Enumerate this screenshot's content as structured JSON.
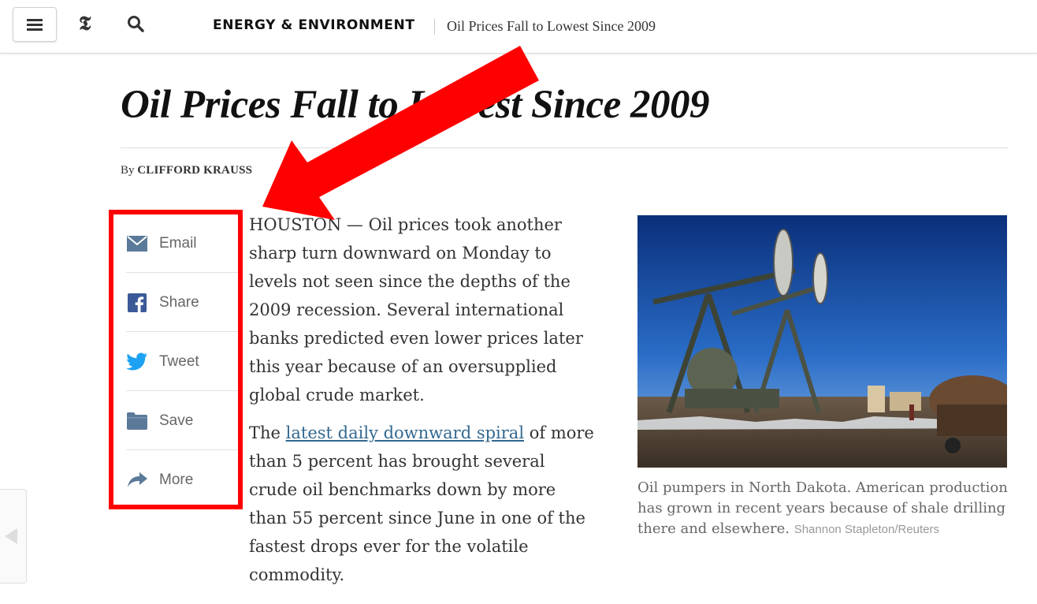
{
  "header": {
    "section": "ENERGY & ENVIRONMENT",
    "title": "Oil Prices Fall to Lowest Since 2009"
  },
  "article": {
    "headline": "Oil Prices Fall to Lowest Since 2009",
    "byline_prefix": "By",
    "byline_author": "CLIFFORD KRAUSS",
    "para1": "HOUSTON — Oil prices took another sharp turn downward on Monday to levels not seen since the depths of the 2009 recession. Several international banks predicted even lower prices later this year because of an oversupplied global crude market.",
    "para2_before": "The",
    "para2_link": "latest daily downward spiral",
    "para2_after": "of more than 5 percent has brought several crude oil benchmarks down by more than 55 percent since June in one of the fastest drops ever for the volatile commodity."
  },
  "share_tools": [
    {
      "label": "Email",
      "icon": "envelope-icon"
    },
    {
      "label": "Share",
      "icon": "facebook-icon"
    },
    {
      "label": "Tweet",
      "icon": "twitter-icon"
    },
    {
      "label": "Save",
      "icon": "folder-icon"
    },
    {
      "label": "More",
      "icon": "share-arrow-icon"
    }
  ],
  "photo": {
    "caption": "Oil pumpers in North Dakota. American production has grown in recent years because of shale drilling there and elsewhere.",
    "credit": "Shannon Stapleton/Reuters"
  },
  "colors": {
    "annotation_red": "#ff0000",
    "link_blue": "#326891",
    "facebook_blue": "#3b5998",
    "twitter_blue": "#1da1f2",
    "icon_gray_blue": "#5b7a99"
  }
}
